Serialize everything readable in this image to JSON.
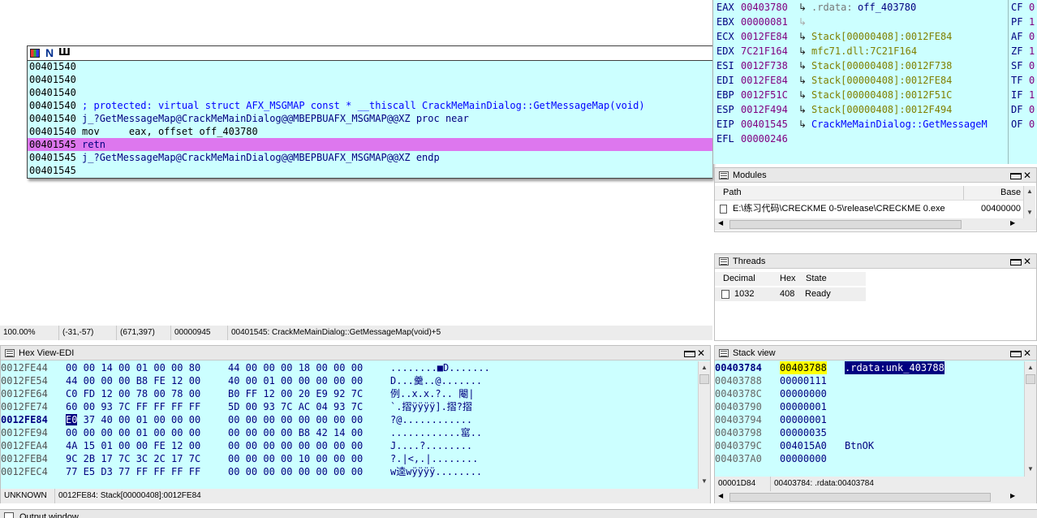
{
  "disasm": {
    "toolbar": {
      "icon1": "grid-icon",
      "icon2": "N",
      "icon3": "Ш"
    },
    "lines": [
      {
        "addr": "00401540",
        "text": ""
      },
      {
        "addr": "00401540",
        "text": ""
      },
      {
        "addr": "00401540",
        "text": ""
      },
      {
        "addr": "00401540",
        "text": " ; protected: virtual struct AFX_MSGMAP const * __thiscall CrackMeMainDialog::GetMessageMap(void)"
      },
      {
        "addr": "00401540",
        "text": " j_?GetMessageMap@CrackMeMainDialog@@MBEPBUAFX_MSGMAP@@XZ proc near"
      },
      {
        "addr": "00401540",
        "text": " mov     eax, offset off_403780"
      },
      {
        "addr": "00401545",
        "text": " retn"
      },
      {
        "addr": "00401545",
        "text": " j_?GetMessageMap@CrackMeMainDialog@@MBEPBUAFX_MSGMAP@@XZ endp"
      },
      {
        "addr": "00401545",
        "text": ""
      }
    ],
    "status": {
      "zoom": "100.00%",
      "coords": "(-31,-57)",
      "pos": "(671,397)",
      "offset": "00000945",
      "location": "00401545: CrackMeMainDialog::GetMessageMap(void)+5"
    }
  },
  "registers": [
    {
      "name": "EAX",
      "value": "00403780",
      "ref_prefix": ".rdata:",
      "ref": "off_403780"
    },
    {
      "name": "EBX",
      "value": "00000081",
      "ref_prefix": "",
      "ref": ""
    },
    {
      "name": "ECX",
      "value": "0012FE84",
      "ref_prefix": "",
      "ref": "Stack[00000408]:0012FE84"
    },
    {
      "name": "EDX",
      "value": "7C21F164",
      "ref_prefix": "",
      "ref": "mfc71.dll:7C21F164"
    },
    {
      "name": "ESI",
      "value": "0012F738",
      "ref_prefix": "",
      "ref": "Stack[00000408]:0012F738"
    },
    {
      "name": "EDI",
      "value": "0012FE84",
      "ref_prefix": "",
      "ref": "Stack[00000408]:0012FE84"
    },
    {
      "name": "EBP",
      "value": "0012F51C",
      "ref_prefix": "",
      "ref": "Stack[00000408]:0012F51C"
    },
    {
      "name": "ESP",
      "value": "0012F494",
      "ref_prefix": "",
      "ref": "Stack[00000408]:0012F494"
    },
    {
      "name": "EIP",
      "value": "00401545",
      "ref_prefix": "",
      "ref": "CrackMeMainDialog::GetMessageM"
    },
    {
      "name": "EFL",
      "value": "00000246",
      "ref_prefix": "",
      "ref": ""
    }
  ],
  "flags": [
    {
      "name": "CF",
      "value": "0"
    },
    {
      "name": "PF",
      "value": "1"
    },
    {
      "name": "AF",
      "value": "0"
    },
    {
      "name": "ZF",
      "value": "1"
    },
    {
      "name": "SF",
      "value": "0"
    },
    {
      "name": "TF",
      "value": "0"
    },
    {
      "name": "IF",
      "value": "1"
    },
    {
      "name": "DF",
      "value": "0"
    },
    {
      "name": "OF",
      "value": "0"
    }
  ],
  "modules": {
    "title": "Modules",
    "col_path": "Path",
    "col_base": "Base",
    "row": {
      "path": "E:\\练习代码\\CRECKME 0-5\\release\\CRECKME 0.exe",
      "base": "00400000"
    }
  },
  "threads": {
    "title": "Threads",
    "col_decimal": "Decimal",
    "col_hex": "Hex",
    "col_state": "State",
    "row": {
      "decimal": "1032",
      "hex": "408",
      "state": "Ready"
    }
  },
  "hexview": {
    "title": "Hex View-EDI",
    "rows": [
      {
        "addr": "0012FE44",
        "b1": "00 00 14 00 01 00 00 80",
        "b2": "44 00 00 00 18 00 00 00",
        "ascii": "........■D......."
      },
      {
        "addr": "0012FE54",
        "b1": "44 00 00 00 B8 FE 12 00",
        "b2": "40 00 01 00 00 00 00 00",
        "ascii": "D...羹..@......."
      },
      {
        "addr": "0012FE64",
        "b1": "C0 FD 12 00 78 00 78 00",
        "b2": "B0 FF 12 00 20 E9 92 7C",
        "ascii": "例..x.x.?.. 閹|"
      },
      {
        "addr": "0012FE74",
        "b1": "60 00 93 7C FF FF FF FF",
        "b2": "5D 00 93 7C AC 04 93 7C",
        "ascii": "`.摺ÿÿÿÿ].摺?摺"
      },
      {
        "addr": "0012FE84",
        "b1": "E0 37 40 00 01 00 00 00",
        "b2": "00 00 00 00 00 00 00 00",
        "ascii": "?@............"
      },
      {
        "addr": "0012FE94",
        "b1": "00 00 00 00 01 00 00 00",
        "b2": "00 00 00 00 B8 42 14 00",
        "ascii": "............窰.."
      },
      {
        "addr": "0012FEA4",
        "b1": "4A 15 01 00 00 FE 12 00",
        "b2": "00 00 00 00 00 00 00 00",
        "ascii": "J....?........"
      },
      {
        "addr": "0012FEB4",
        "b1": "9C 2B 17 7C 3C 2C 17 7C",
        "b2": "00 00 00 00 10 00 00 00",
        "ascii": "?.|<,.|........"
      },
      {
        "addr": "0012FEC4",
        "b1": "77 E5 D3 77 FF FF FF FF",
        "b2": "00 00 00 00 00 00 00 00",
        "ascii": "w逵wÿÿÿÿ........"
      }
    ],
    "highlight_byte": "E0",
    "status": {
      "left": "UNKNOWN",
      "right": "0012FE84: Stack[00000408]:0012FE84"
    }
  },
  "stack": {
    "title": "Stack view",
    "rows": [
      {
        "addr": "00403784",
        "value": "00403788",
        "comment": ".rdata:unk_403788"
      },
      {
        "addr": "00403788",
        "value": "00000111",
        "comment": ""
      },
      {
        "addr": "0040378C",
        "value": "00000000",
        "comment": ""
      },
      {
        "addr": "00403790",
        "value": "00000001",
        "comment": ""
      },
      {
        "addr": "00403794",
        "value": "00000001",
        "comment": ""
      },
      {
        "addr": "00403798",
        "value": "00000035",
        "comment": ""
      },
      {
        "addr": "0040379C",
        "value": "004015A0",
        "comment": "BtnOK"
      },
      {
        "addr": "004037A0",
        "value": "00000000",
        "comment": ""
      }
    ],
    "status": {
      "left": "00001D84",
      "right": "00403784: .rdata:00403784"
    }
  },
  "output": {
    "title": "Output window"
  },
  "colors": {
    "cyan": "#ccffff",
    "magenta": "#dd77ee",
    "navy": "#000080",
    "purple": "#800080",
    "olive": "#808000",
    "blue": "#0000ff"
  }
}
